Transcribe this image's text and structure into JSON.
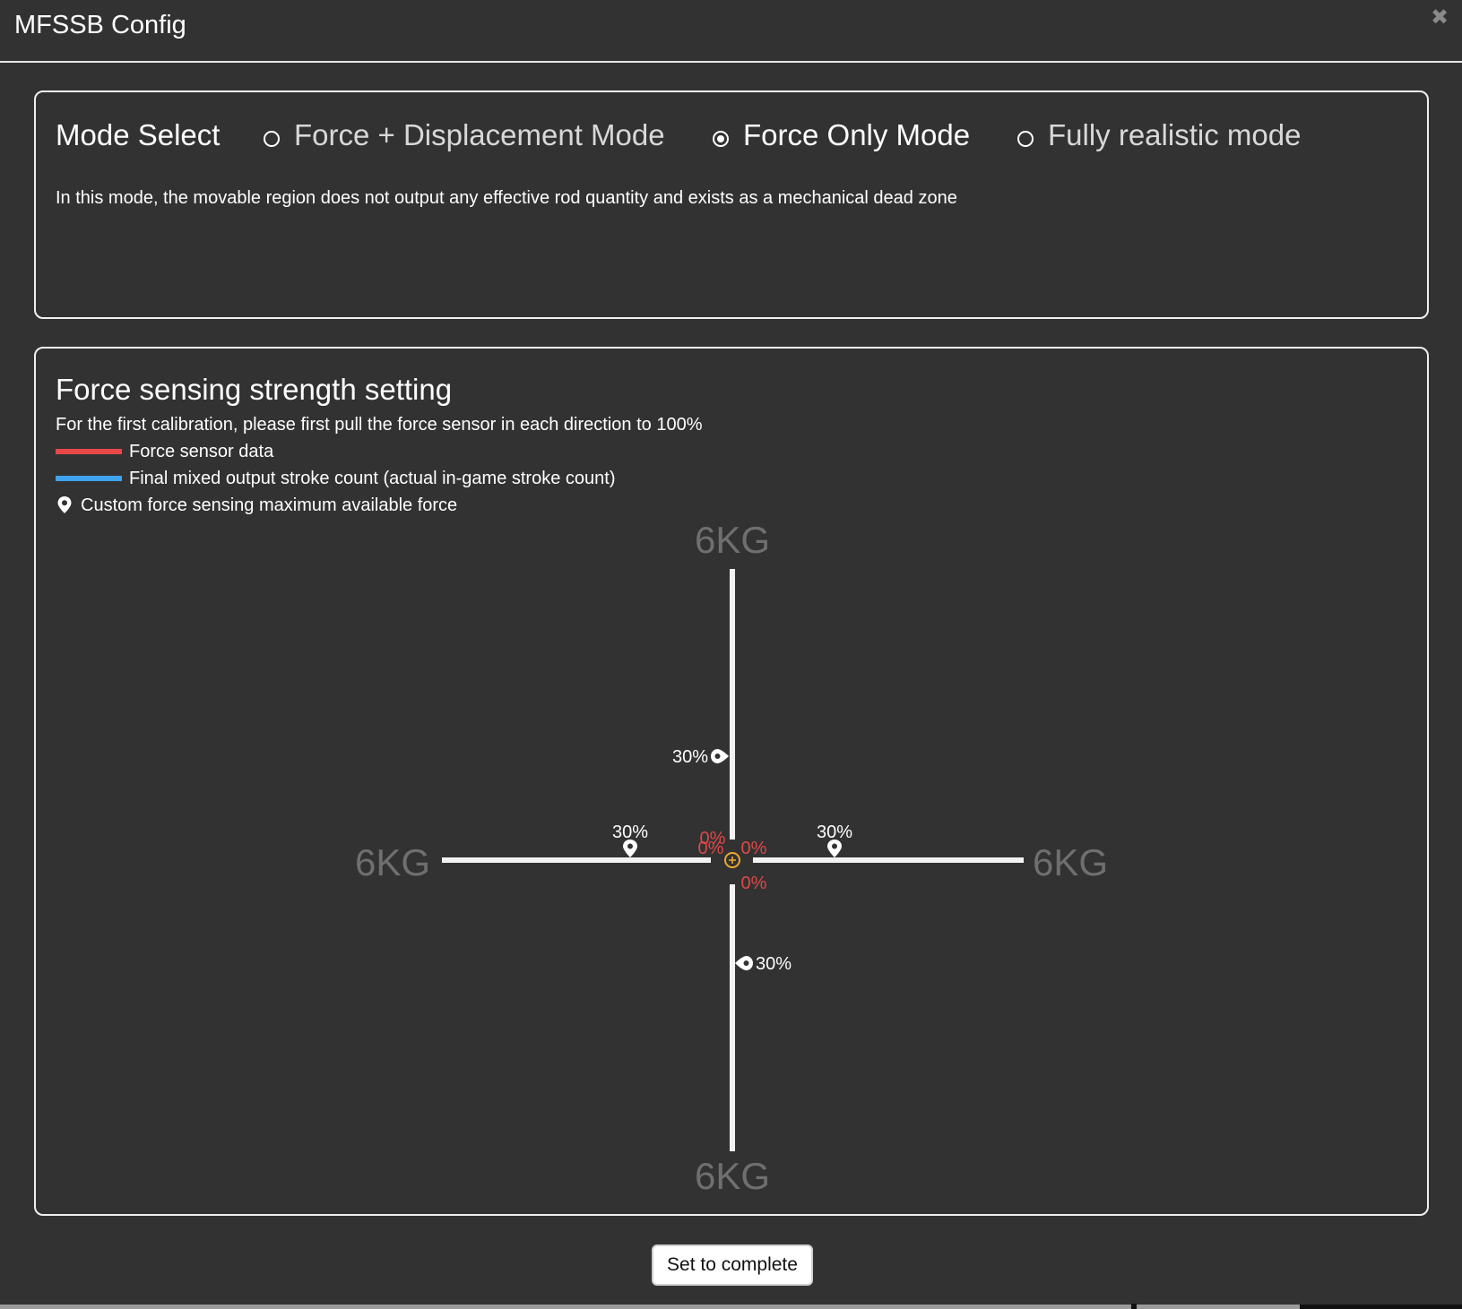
{
  "window": {
    "title": "MFSSB Config",
    "close_glyph": "✖"
  },
  "mode_select": {
    "label": "Mode Select",
    "options": [
      {
        "label": "Force + Displacement Mode",
        "checked": false
      },
      {
        "label": "Force Only Mode",
        "checked": true
      },
      {
        "label": "Fully realistic mode",
        "checked": false
      }
    ],
    "description": "In this mode, the movable region does not output any effective rod quantity and exists as a mechanical dead zone"
  },
  "force_setting": {
    "title": "Force sensing strength setting",
    "note": "For the first calibration, please first pull the force sensor in each direction to 100%",
    "legend": [
      {
        "label": "Force sensor data",
        "color": "#e84848"
      },
      {
        "label": "Final mixed output stroke count (actual in-game stroke count)",
        "color": "#3fa3ee"
      },
      {
        "label": "Custom force sensing maximum available force",
        "icon": "location-pin-icon"
      }
    ],
    "axes": {
      "up": {
        "max": "6KG",
        "marker": "30%",
        "value": "0%"
      },
      "down": {
        "max": "6KG",
        "marker": "30%",
        "value": "0%"
      },
      "left": {
        "max": "6KG",
        "marker": "30%",
        "value": "0%"
      },
      "right": {
        "max": "6KG",
        "marker": "30%",
        "value": "0%"
      }
    },
    "center_icon": "crosshair-target-icon",
    "accent_color": "#e8a830"
  },
  "footer": {
    "button_label": "Set to complete"
  }
}
